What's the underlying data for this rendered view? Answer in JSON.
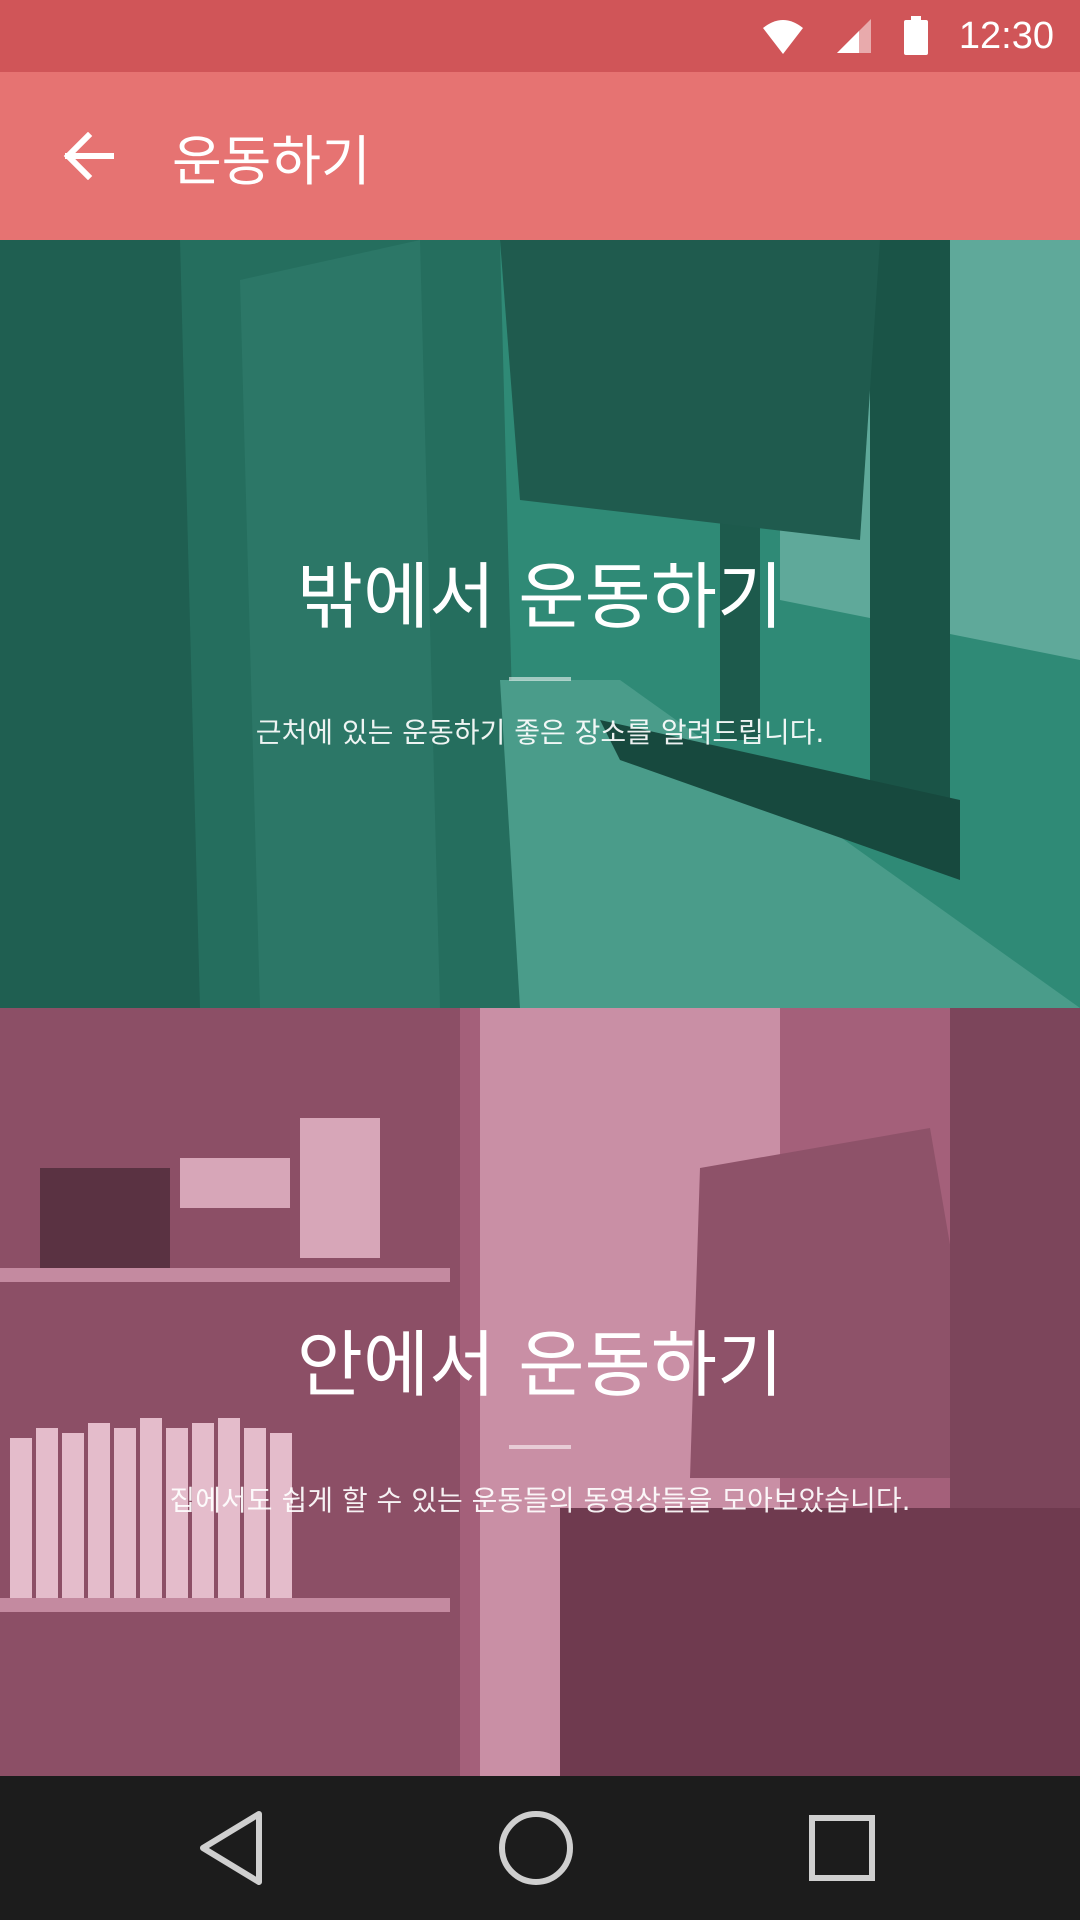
{
  "status_bar": {
    "time": "12:30",
    "icons": [
      "wifi-icon",
      "signal-icon",
      "battery-icon"
    ],
    "color": "#d05558"
  },
  "app_bar": {
    "title": "운동하기",
    "back_icon": "arrow-back-icon",
    "color": "#e67372"
  },
  "cards": [
    {
      "title": "밖에서 운동하기",
      "subtitle": "근처에 있는 운동하기 좋은 장소를 알려드립니다.",
      "tint": "#2f8a76"
    },
    {
      "title": "안에서 운동하기",
      "subtitle": "집에서도 쉽게 할 수 있는 운동들의 동영상들을 모아보았습니다.",
      "tint": "#a4607a"
    }
  ],
  "nav_bar": {
    "icons": [
      "back-triangle-icon",
      "home-circle-icon",
      "recents-square-icon"
    ]
  }
}
